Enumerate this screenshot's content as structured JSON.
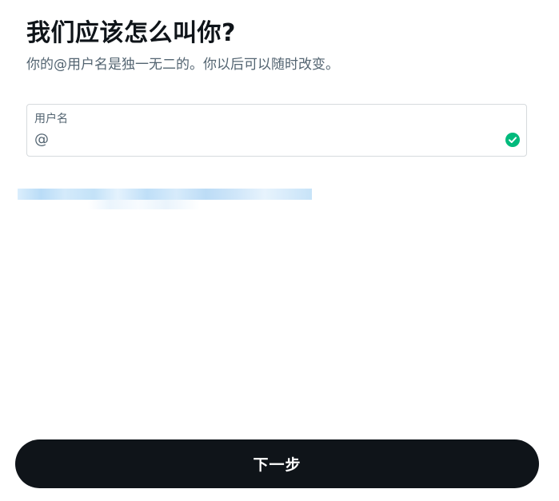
{
  "header": {
    "title": "我们应该怎么叫你?",
    "subtitle": "你的@用户名是独一无二的。你以后可以随时改变。"
  },
  "username_field": {
    "label": "用户名",
    "prefix": "@",
    "value": "",
    "valid_icon": "check-circle-icon",
    "valid_color": "#00ba7c"
  },
  "suggestions": {
    "link_color": "#1d9bf0"
  },
  "footer": {
    "next_label": "下一步",
    "button_color": "#0f1419"
  }
}
